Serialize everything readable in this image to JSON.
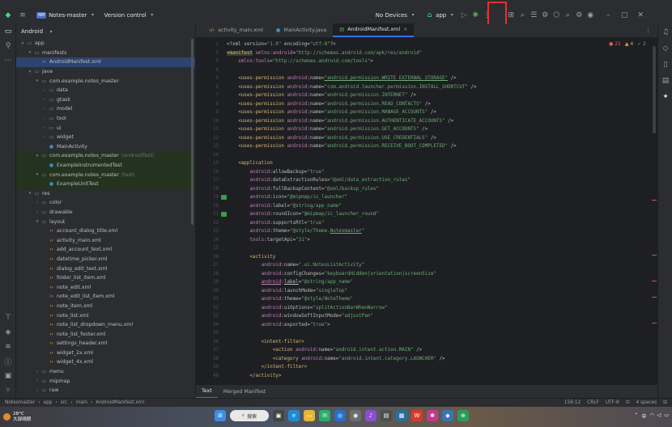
{
  "titlebar": {
    "project_badge": "NM",
    "project_name": "Notes-master",
    "vcs": "Version control",
    "devices": "No Devices",
    "run_config": "app",
    "window_min": "–",
    "window_max": "▢",
    "window_close": "✕"
  },
  "project_panel": {
    "view": "Android",
    "tree": [
      {
        "level": 0,
        "arrow": "▾",
        "icon": "folder",
        "label": "app",
        "style": ""
      },
      {
        "level": 1,
        "arrow": "▾",
        "icon": "folder",
        "label": "manifests",
        "style": ""
      },
      {
        "level": 2,
        "arrow": "",
        "icon": "xml",
        "label": "AndroidManifest.xml",
        "style": "sel"
      },
      {
        "level": 1,
        "arrow": "▾",
        "icon": "folder",
        "label": "java",
        "style": ""
      },
      {
        "level": 2,
        "arrow": "▾",
        "icon": "folder",
        "label": "com.example.notes_master",
        "style": ""
      },
      {
        "level": 3,
        "arrow": "›",
        "icon": "folder",
        "label": "data",
        "style": ""
      },
      {
        "level": 3,
        "arrow": "›",
        "icon": "folder",
        "label": "gtask",
        "style": ""
      },
      {
        "level": 3,
        "arrow": "›",
        "icon": "folder",
        "label": "model",
        "style": ""
      },
      {
        "level": 3,
        "arrow": "›",
        "icon": "folder",
        "label": "tool",
        "style": ""
      },
      {
        "level": 3,
        "arrow": "›",
        "icon": "folder",
        "label": "ui",
        "style": ""
      },
      {
        "level": 3,
        "arrow": "›",
        "icon": "folder",
        "label": "widget",
        "style": ""
      },
      {
        "level": 3,
        "arrow": "",
        "icon": "cls",
        "label": "MainActivity",
        "style": ""
      },
      {
        "level": 2,
        "arrow": "▾",
        "icon": "folder",
        "label": "com.example.notes_master",
        "suffix": "(androidTest)",
        "style": "test"
      },
      {
        "level": 3,
        "arrow": "",
        "icon": "cls",
        "label": "ExampleInstrumentedTest",
        "style": "test"
      },
      {
        "level": 2,
        "arrow": "▾",
        "icon": "folder",
        "label": "com.example.notes_master",
        "suffix": "(test)",
        "style": "test"
      },
      {
        "level": 3,
        "arrow": "",
        "icon": "cls",
        "label": "ExampleUnitTest",
        "style": "test"
      },
      {
        "level": 1,
        "arrow": "▾",
        "icon": "folder",
        "label": "res",
        "style": ""
      },
      {
        "level": 2,
        "arrow": "›",
        "icon": "folder",
        "label": "color",
        "style": ""
      },
      {
        "level": 2,
        "arrow": "›",
        "icon": "folder",
        "label": "drawable",
        "style": ""
      },
      {
        "level": 2,
        "arrow": "▾",
        "icon": "folder",
        "label": "layout",
        "style": ""
      },
      {
        "level": 3,
        "arrow": "",
        "icon": "xml",
        "label": "account_dialog_title.xml",
        "style": ""
      },
      {
        "level": 3,
        "arrow": "",
        "icon": "xml",
        "label": "activity_main.xml",
        "style": ""
      },
      {
        "level": 3,
        "arrow": "",
        "icon": "xml",
        "label": "add_account_text.xml",
        "style": ""
      },
      {
        "level": 3,
        "arrow": "",
        "icon": "xml",
        "label": "datetime_picker.xml",
        "style": ""
      },
      {
        "level": 3,
        "arrow": "",
        "icon": "xml",
        "label": "dialog_edit_text.xml",
        "style": ""
      },
      {
        "level": 3,
        "arrow": "",
        "icon": "xml",
        "label": "folder_list_item.xml",
        "style": ""
      },
      {
        "level": 3,
        "arrow": "",
        "icon": "xml",
        "label": "note_edit.xml",
        "style": ""
      },
      {
        "level": 3,
        "arrow": "",
        "icon": "xml",
        "label": "note_edit_list_item.xml",
        "style": ""
      },
      {
        "level": 3,
        "arrow": "",
        "icon": "xml",
        "label": "note_item.xml",
        "style": ""
      },
      {
        "level": 3,
        "arrow": "",
        "icon": "xml",
        "label": "note_list.xml",
        "style": ""
      },
      {
        "level": 3,
        "arrow": "",
        "icon": "xml",
        "label": "note_list_dropdown_menu.xml",
        "style": ""
      },
      {
        "level": 3,
        "arrow": "",
        "icon": "xml",
        "label": "note_list_footer.xml",
        "style": ""
      },
      {
        "level": 3,
        "arrow": "",
        "icon": "xml",
        "label": "settings_header.xml",
        "style": ""
      },
      {
        "level": 3,
        "arrow": "",
        "icon": "xml",
        "label": "widget_2x.xml",
        "style": ""
      },
      {
        "level": 3,
        "arrow": "",
        "icon": "xml",
        "label": "widget_4x.xml",
        "style": ""
      },
      {
        "level": 2,
        "arrow": "›",
        "icon": "folder",
        "label": "menu",
        "style": ""
      },
      {
        "level": 2,
        "arrow": "›",
        "icon": "folder",
        "label": "mipmap",
        "style": ""
      },
      {
        "level": 2,
        "arrow": "›",
        "icon": "folder",
        "label": "raw",
        "style": ""
      }
    ]
  },
  "tabs": [
    {
      "label": "activity_main.xml",
      "icon": "xml",
      "active": false
    },
    {
      "label": "MainActivity.java",
      "icon": "cls",
      "active": false
    },
    {
      "label": "AndroidManifest.xml",
      "icon": "manifest",
      "active": true
    }
  ],
  "inspections": {
    "errors": "21",
    "warnings": "4",
    "weak": "2"
  },
  "editor": {
    "lines": [
      {
        "n": "1",
        "html": "<span class='t-pi'>&lt;?xml version=</span><span class='t-str'>\"1.0\"</span><span class='t-pi'> encoding=</span><span class='t-str'>\"utf-8\"</span><span class='t-pi'>?&gt;</span>"
      },
      {
        "n": "2",
        "html": "<span class='t-tag manifest-hl'>&lt;manifest</span> <span class='t-ns'>xmlns:android</span>=<span class='t-str'>\"http://schemas.android.com/apk/res/android\"</span>"
      },
      {
        "n": "3",
        "html": "    <span class='t-ns'>xmlns:tools</span>=<span class='t-str'>\"http://schemas.android.com/tools\"</span>&gt;"
      },
      {
        "n": "4",
        "html": ""
      },
      {
        "n": "5",
        "html": "    <span class='t-tag'>&lt;uses-permission</span> <span class='t-ns'>android</span>:<span class='t-attr'>name</span>=<span class='t-link'>\"android.permission.WRITE_EXTERNAL_STORAGE\"</span> /&gt;"
      },
      {
        "n": "6",
        "html": "    <span class='t-tag'>&lt;uses-permission</span> <span class='t-ns'>android</span>:<span class='t-attr'>name</span>=<span class='t-str'>\"com.android.launcher.permission.INSTALL_SHORTCUT\"</span> /&gt;"
      },
      {
        "n": "7",
        "html": "    <span class='t-tag'>&lt;uses-permission</span> <span class='t-ns'>android</span>:<span class='t-attr'>name</span>=<span class='t-str'>\"android.permission.INTERNET\"</span> /&gt;"
      },
      {
        "n": "8",
        "html": "    <span class='t-tag'>&lt;uses-permission</span> <span class='t-ns'>android</span>:<span class='t-attr'>name</span>=<span class='t-str'>\"android.permission.READ_CONTACTS\"</span> /&gt;"
      },
      {
        "n": "9",
        "html": "    <span class='t-tag'>&lt;uses-permission</span> <span class='t-ns'>android</span>:<span class='t-attr'>name</span>=<span class='t-str'>\"android.permission.MANAGE_ACCOUNTS\"</span> /&gt;"
      },
      {
        "n": "10",
        "html": "    <span class='t-tag'>&lt;uses-permission</span> <span class='t-ns'>android</span>:<span class='t-attr'>name</span>=<span class='t-str'>\"android.permission.AUTHENTICATE_ACCOUNTS\"</span> /&gt;"
      },
      {
        "n": "11",
        "html": "    <span class='t-tag'>&lt;uses-permission</span> <span class='t-ns'>android</span>:<span class='t-attr'>name</span>=<span class='t-str'>\"android.permission.GET_ACCOUNTS\"</span> /&gt;"
      },
      {
        "n": "12",
        "html": "    <span class='t-tag'>&lt;uses-permission</span> <span class='t-ns'>android</span>:<span class='t-attr'>name</span>=<span class='t-str'>\"android.permission.USE_CREDENTIALS\"</span> /&gt;"
      },
      {
        "n": "13",
        "html": "    <span class='t-tag'>&lt;uses-permission</span> <span class='t-ns'>android</span>:<span class='t-attr'>name</span>=<span class='t-str'>\"android.permission.RECEIVE_BOOT_COMPLETED\"</span> /&gt;"
      },
      {
        "n": "14",
        "html": ""
      },
      {
        "n": "15",
        "html": "    <span class='t-tag'>&lt;application</span>"
      },
      {
        "n": "16",
        "html": "        <span class='t-ns'>android</span>:<span class='t-attr'>allowBackup</span>=<span class='t-str'>\"true\"</span>"
      },
      {
        "n": "17",
        "html": "        <span class='t-ns'>android</span>:<span class='t-attr'>dataExtractionRules</span>=<span class='t-str'>\"@xml/data_extraction_rules\"</span>"
      },
      {
        "n": "18",
        "html": "        <span class='t-ns'>android</span>:<span class='t-attr'>fullBackupContent</span>=<span class='t-str'>\"@xml/backup_rules\"</span>"
      },
      {
        "n": "19",
        "html": "        <span class='t-ns'>android</span>:<span class='t-attr'>icon</span>=<span class='t-str'>\"@mipmap/ic_launcher\"</span>",
        "gimg": true
      },
      {
        "n": "20",
        "html": "        <span class='t-ns'>android</span>:<span class='t-attr'>label</span>=<span class='t-str'>\"@string/app_name\"</span>"
      },
      {
        "n": "21",
        "html": "        <span class='t-ns'>android</span>:<span class='t-attr'>roundIcon</span>=<span class='t-str'>\"@mipmap/ic_launcher_round\"</span>",
        "gimg": true
      },
      {
        "n": "22",
        "html": "        <span class='t-ns'>android</span>:<span class='t-attr'>supportsRtl</span>=<span class='t-str'>\"true\"</span>"
      },
      {
        "n": "23",
        "html": "        <span class='t-ns'>android</span>:<span class='t-attr'>theme</span>=<span class='t-str'>\"@style/Theme.</span><span class='t-link'>Notesmaster</span><span class='t-str'>\"</span>"
      },
      {
        "n": "24",
        "html": "        <span class='t-ns'>tools</span>:<span class='t-attr'>targetApi</span>=<span class='t-str'>\"31\"</span>&gt;"
      },
      {
        "n": "25",
        "html": ""
      },
      {
        "n": "26",
        "html": "        <span class='t-tag'>&lt;activity</span>"
      },
      {
        "n": "27",
        "html": "            <span class='t-ns'>android</span>:<span class='t-attr'>name</span>=<span class='t-str'>\".ui.NotesListActivity\"</span>"
      },
      {
        "n": "28",
        "html": "            <span class='t-ns'>android</span>:<span class='t-attr'>configChanges</span>=<span class='t-str'>\"keyboardHidden|orientation|screenSize\"</span>"
      },
      {
        "n": "29",
        "html": "            <span class='t-ns' style='text-decoration:underline'>android</span>:<span class='t-attr' style='text-decoration:underline'>label</span>=<span class='t-str'>\"@string/app_name\"</span>"
      },
      {
        "n": "30",
        "html": "            <span class='t-ns'>android</span>:<span class='t-attr'>launchMode</span>=<span class='t-str'>\"singleTop\"</span>"
      },
      {
        "n": "31",
        "html": "            <span class='t-ns'>android</span>:<span class='t-attr'>theme</span>=<span class='t-str'>\"@style/NoteTheme\"</span>"
      },
      {
        "n": "32",
        "html": "            <span class='t-ns'>android</span>:<span class='t-attr'>uiOptions</span>=<span class='t-str'>\"splitActionBarWhenNarrow\"</span>"
      },
      {
        "n": "33",
        "html": "            <span class='t-ns'>android</span>:<span class='t-attr'>windowSoftInputMode</span>=<span class='t-str'>\"adjustPan\"</span>"
      },
      {
        "n": "34",
        "html": "            <span class='t-ns'>android</span>:<span class='t-attr'>exported</span>=<span class='t-str'>\"true\"</span>&gt;"
      },
      {
        "n": "35",
        "html": ""
      },
      {
        "n": "36",
        "html": "            <span class='t-tag'>&lt;intent-filter&gt;</span>"
      },
      {
        "n": "37",
        "html": "                <span class='t-tag'>&lt;action</span> <span class='t-ns'>android</span>:<span class='t-attr'>name</span>=<span class='t-str'>\"android.intent.action.MAIN\"</span> /&gt;"
      },
      {
        "n": "38",
        "html": "                <span class='t-tag'>&lt;category</span> <span class='t-ns'>android</span>:<span class='t-attr'>name</span>=<span class='t-str'>\"android.intent.category.LAUNCHER\"</span> /&gt;"
      },
      {
        "n": "39",
        "html": "            <span class='t-tag'>&lt;/intent-filter&gt;</span>"
      },
      {
        "n": "40",
        "html": "        <span class='t-tag'>&lt;/activity&gt;</span>"
      }
    ]
  },
  "bottom_tabs": [
    {
      "label": "Text",
      "active": true
    },
    {
      "label": "Merged Manifest",
      "active": false
    }
  ],
  "status": {
    "crumbs": [
      "Notesmaster",
      "app",
      "src",
      "main",
      "AndroidManifest.xml"
    ],
    "position": "156:12",
    "line_sep": "CRLF",
    "encoding": "UTF-8",
    "indent": "4 spaces"
  },
  "taskbar": {
    "temp": "28°C",
    "weather": "大部晴朗",
    "search": "搜索"
  }
}
